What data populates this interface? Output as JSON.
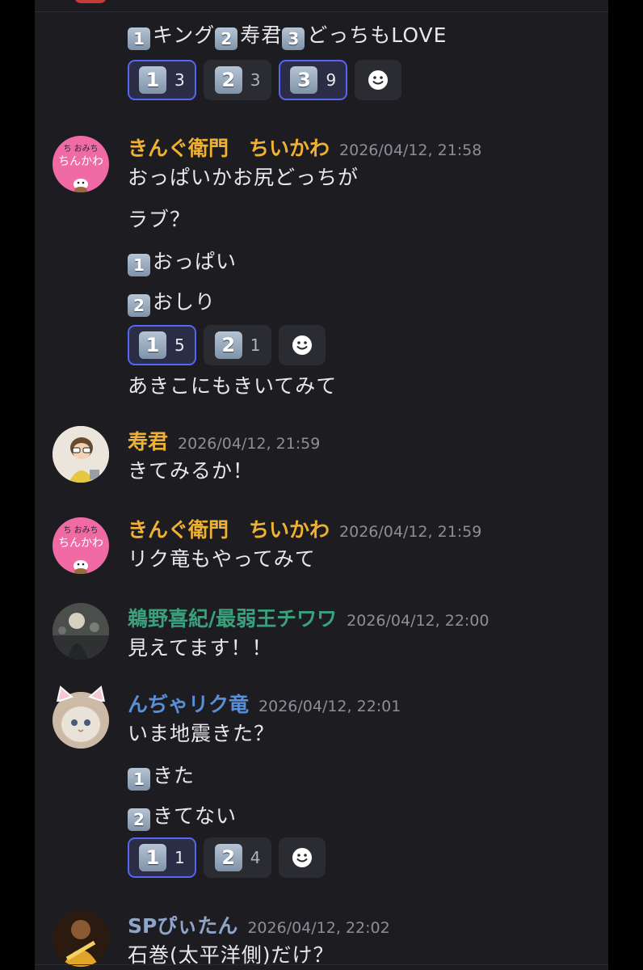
{
  "colors": {
    "gold": "#f0b132",
    "green": "#3aa17c",
    "blue": "#5a8fd8",
    "slate": "#8ea5c8",
    "accent": "#5865f2"
  },
  "keycap_icon": "keycap-digit",
  "add_reaction_icon": "smile-icon",
  "messages": [
    {
      "lines": [
        "キング",
        "寿君",
        "どっちもLOVE"
      ],
      "reactions": [
        {
          "emoji": "1",
          "count": "3",
          "active": true
        },
        {
          "emoji": "2",
          "count": "3",
          "active": false
        },
        {
          "emoji": "3",
          "count": "9",
          "active": true
        }
      ]
    },
    {
      "user": "きんぐ衛門　ちいかわ",
      "timestamp": "2026/04/12, 21:58",
      "avatar_text": [
        "ち おみち",
        "ちんかわ"
      ],
      "lines": [
        "おっぱいかお尻どっちが",
        "ラブ？",
        "おっぱい",
        "おしり",
        "あきこにもきいてみて"
      ],
      "reactions": [
        {
          "emoji": "1",
          "count": "5",
          "active": true
        },
        {
          "emoji": "2",
          "count": "1",
          "active": false
        }
      ]
    },
    {
      "user": "寿君",
      "timestamp": "2026/04/12, 21:59",
      "lines": [
        "きてみるか！"
      ]
    },
    {
      "user": "きんぐ衛門　ちいかわ",
      "timestamp": "2026/04/12, 21:59",
      "avatar_text": [
        "ち おみち",
        "ちんかわ"
      ],
      "lines": [
        "リク竜もやってみて"
      ]
    },
    {
      "user": "鵜野喜紀/最弱王チワワ",
      "timestamp": "2026/04/12, 22:00",
      "lines": [
        "見えてます！！"
      ]
    },
    {
      "user": "んぢゃリク竜",
      "timestamp": "2026/04/12, 22:01",
      "lines": [
        "いま地震きた？",
        "きた",
        "きてない"
      ],
      "reactions": [
        {
          "emoji": "1",
          "count": "1",
          "active": true
        },
        {
          "emoji": "2",
          "count": "4",
          "active": false
        }
      ]
    },
    {
      "user": "SPぴぃたん",
      "timestamp": "2026/04/12, 22:02",
      "lines": [
        "石巻(太平洋側)だけ？"
      ]
    }
  ]
}
